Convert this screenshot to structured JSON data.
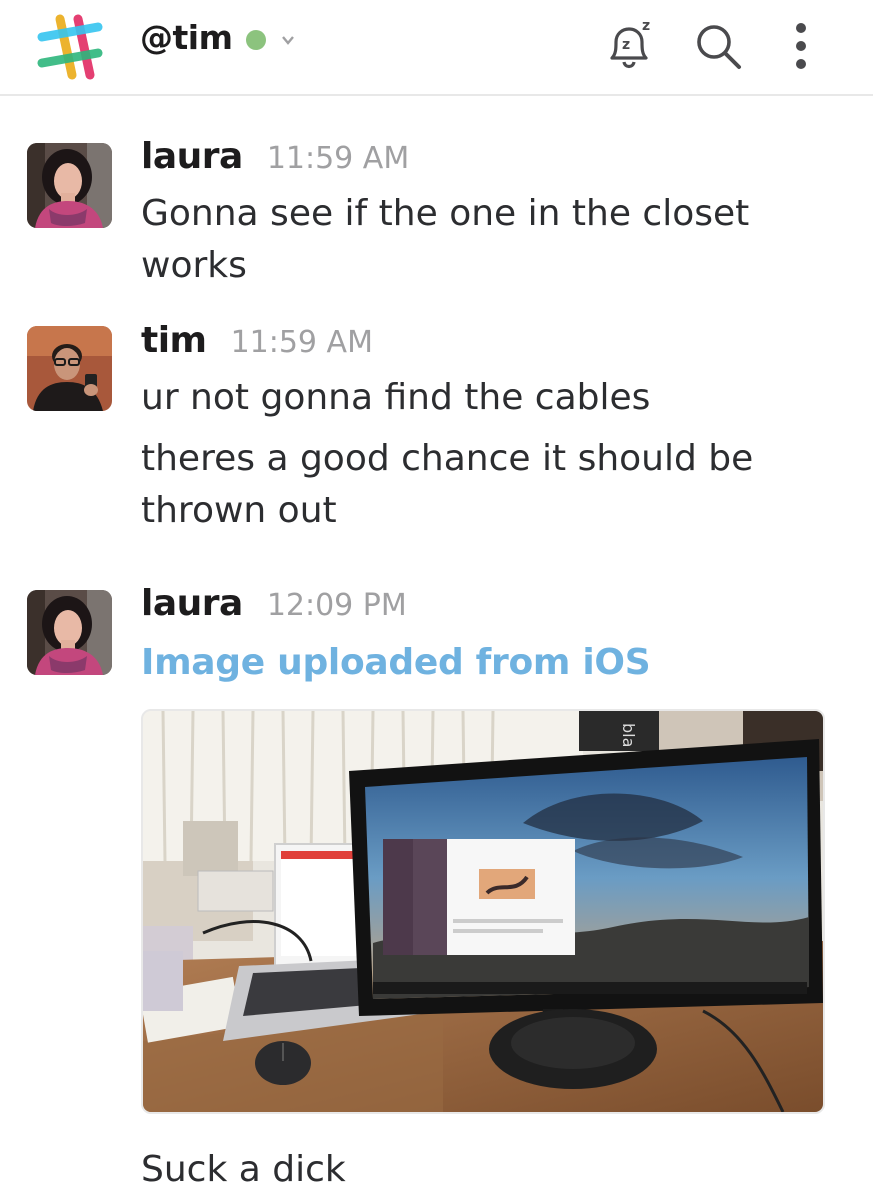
{
  "header": {
    "channel_name": "@tim",
    "icons": {
      "logo": "slack-logo-icon",
      "presence": "presence-dot-icon",
      "dropdown": "chevron-down-icon",
      "snooze": "bell-snooze-icon",
      "search": "search-icon",
      "more": "more-vertical-icon"
    },
    "colors": {
      "presence": "#8cc37e"
    }
  },
  "messages": [
    {
      "author": "laura",
      "time": "11:59 AM",
      "lines": [
        "Gonna see if the one in the closet works"
      ]
    },
    {
      "author": "tim",
      "time": "11:59 AM",
      "lines": [
        "ur not gonna find the cables",
        "theres a good chance it should be thrown out"
      ]
    },
    {
      "author": "laura",
      "time": "12:09 PM",
      "attachment_title": "Image uploaded from iOS",
      "attachment_visible_text": "bla",
      "lines": [
        "Suck a dick"
      ]
    }
  ],
  "colors": {
    "link": "#6fb2e0",
    "timestamp": "#a0a0a2",
    "text": "#2c2d30"
  }
}
